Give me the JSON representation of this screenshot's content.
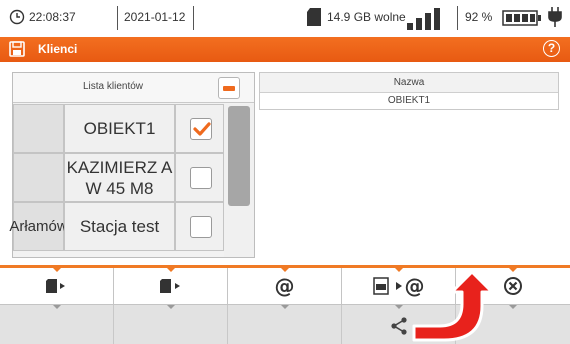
{
  "status_bar": {
    "time": "22:08:37",
    "date": "2021-01-12",
    "storage": "14.9 GB wolne",
    "battery": "92 %"
  },
  "title_bar": {
    "title": "Klienci",
    "help": "?"
  },
  "client_list": {
    "header": "Lista klientów",
    "rows": [
      {
        "col0": "",
        "name": "OBIEKT1",
        "checked": true
      },
      {
        "col0": "",
        "name": "KAZIMIERZ A W 45 M8",
        "checked": false
      },
      {
        "col0": "Arłamów",
        "name": "Stacja test",
        "checked": false
      }
    ]
  },
  "name_panel": {
    "header": "Nazwa",
    "value": "OBIEKT1"
  },
  "toolbar": {
    "email_symbol": "@",
    "pdf_email_symbol": "@",
    "icons": [
      "sd-import-icon",
      "sd-export-icon",
      "email-icon",
      "pdf-email-icon",
      "close-icon"
    ]
  },
  "colors": {
    "accent": "#f07a25",
    "title_bar": "#ef6a1e",
    "annotation_arrow": "#e8221c"
  }
}
